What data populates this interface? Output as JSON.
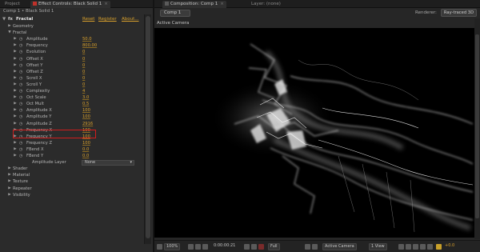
{
  "left_panel": {
    "tabs": {
      "project": "Project",
      "effect_controls": "Effect Controls: Black Solid 1"
    },
    "breadcrumb": "Comp 1 • Black Solid 1",
    "effect": {
      "fx": "fx",
      "name": "Fractal",
      "reset": "Reset",
      "register": "Register",
      "about": "About..."
    },
    "rows": [
      {
        "kind": "group",
        "label": "Geometry",
        "expanded": false,
        "indent": 0
      },
      {
        "kind": "group",
        "label": "Fractal",
        "expanded": true,
        "indent": 0
      },
      {
        "kind": "param",
        "label": "Amplitude",
        "value": "50.0"
      },
      {
        "kind": "param",
        "label": "Frequency",
        "value": "800.00"
      },
      {
        "kind": "param",
        "label": "Evolution",
        "value": "0"
      },
      {
        "kind": "param",
        "label": "Offset X",
        "value": "0"
      },
      {
        "kind": "param",
        "label": "Offset Y",
        "value": "0"
      },
      {
        "kind": "param",
        "label": "Offset Z",
        "value": "0"
      },
      {
        "kind": "param",
        "label": "Scroll X",
        "value": "0"
      },
      {
        "kind": "param",
        "label": "Scroll Y",
        "value": "0"
      },
      {
        "kind": "param",
        "label": "Complexity",
        "value": "4"
      },
      {
        "kind": "param",
        "label": "Oct Scale",
        "value": "3.0"
      },
      {
        "kind": "param",
        "label": "Oct Mult",
        "value": "0.5"
      },
      {
        "kind": "param",
        "label": "Amplitude X",
        "value": "100"
      },
      {
        "kind": "param",
        "label": "Amplitude Y",
        "value": "100"
      },
      {
        "kind": "param",
        "label": "Amplitude Z",
        "value": "2916",
        "selected": true
      },
      {
        "kind": "param",
        "label": "Frequency X",
        "value": "100"
      },
      {
        "kind": "param",
        "label": "Frequency Y",
        "value": "100"
      },
      {
        "kind": "param",
        "label": "Frequency Z",
        "value": "100"
      },
      {
        "kind": "param",
        "label": "FBend X",
        "value": "0.0"
      },
      {
        "kind": "param",
        "label": "FBend Y",
        "value": "0.0"
      },
      {
        "kind": "dropdown",
        "label": "Amplitude Layer",
        "value": "None"
      },
      {
        "kind": "group",
        "label": "Shader",
        "expanded": false,
        "indent": 0
      },
      {
        "kind": "group",
        "label": "Material",
        "expanded": false,
        "indent": 0
      },
      {
        "kind": "group",
        "label": "Texture",
        "expanded": false,
        "indent": 0
      },
      {
        "kind": "group",
        "label": "Repeater",
        "expanded": false,
        "indent": 0
      },
      {
        "kind": "group",
        "label": "Visibility",
        "expanded": false,
        "indent": 0
      }
    ]
  },
  "right_panel": {
    "tabs": {
      "composition": "Composition: Comp 1",
      "layer": "Layer: (none)"
    },
    "comp_dropdown": "Comp 1",
    "renderer_label": "Renderer:",
    "renderer_value": "Ray-traced 3D",
    "view_label": "Active Camera",
    "status": {
      "zoom": "100%",
      "timecode": "0:00:00:21",
      "resolution": "Full",
      "camera": "Active Camera",
      "views": "1 View",
      "exposure": "+0.0"
    }
  },
  "colors": {
    "value_accent": "#d8a02c",
    "selection_outline": "#d11c1c",
    "panel_bg": "#2b2b2b",
    "viewer_bg": "#000000"
  }
}
